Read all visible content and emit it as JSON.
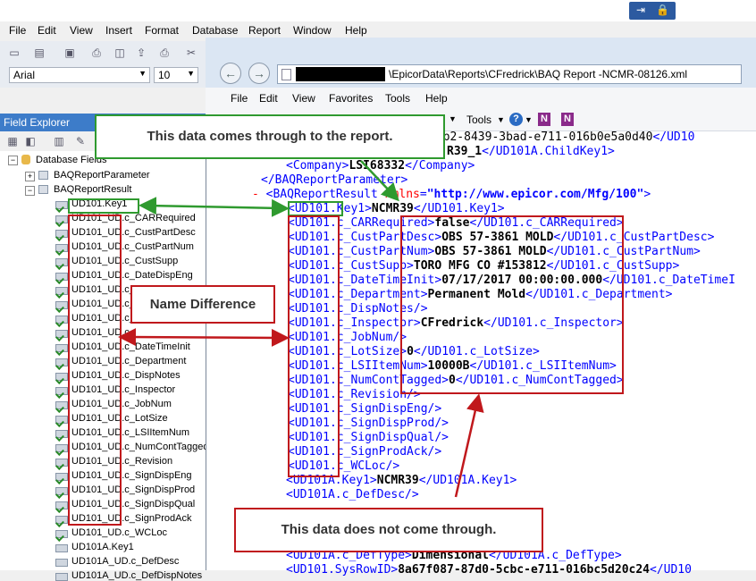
{
  "app": {
    "menu": [
      "File",
      "Edit",
      "View",
      "Insert",
      "Format",
      "Database",
      "Report",
      "Window",
      "Help"
    ],
    "font": {
      "name": "Arial",
      "size": "10"
    },
    "field_explorer_title": "Field Explorer",
    "tree": {
      "root": "Database Fields",
      "params": "BAQReportParameter",
      "result": "BAQReportResult",
      "fields": [
        "UD101.Key1",
        "UD101_UD.c_CARRequired",
        "UD101_UD.c_CustPartDesc",
        "UD101_UD.c_CustPartNum",
        "UD101_UD.c_CustSupp",
        "UD101_UD.c_DateDispEng",
        "UD101_UD.c_",
        "UD101_UD.c_",
        "UD101_UD.c_",
        "UD101_UD.c_",
        "UD101_UD.c_DateTimeInit",
        "UD101_UD.c_Department",
        "UD101_UD.c_DispNotes",
        "UD101_UD.c_Inspector",
        "UD101_UD.c_JobNum",
        "UD101_UD.c_LotSize",
        "UD101_UD.c_LSIItemNum",
        "UD101_UD.c_NumContTagged",
        "UD101_UD.c_Revision",
        "UD101_UD.c_SignDispEng",
        "UD101_UD.c_SignDispProd",
        "UD101_UD.c_SignDispQual",
        "UD101_UD.c_SignProdAck",
        "UD101_UD.c_WCLoc",
        "UD101A.Key1",
        "UD101A_UD.c_DefDesc",
        "UD101A_UD.c_DefDispNotes"
      ]
    }
  },
  "browser": {
    "url": "\\EpicorData\\Reports\\CFredrick\\BAQ Report -NCMR-08126.xml",
    "menu": [
      "File",
      "Edit",
      "View",
      "Favorites",
      "Tools",
      "Help"
    ],
    "tools_label": "Tools"
  },
  "xml": {
    "l0": "3bb2-8439-3bad-e711-016b0e5a0d40",
    "l0_close": "</UD10",
    "l1_val": "R39_1",
    "l1_close": "</UD101A.ChildKey1>",
    "company_open": "<Company>",
    "company_val": "LSI68332",
    "company_close": "</Company>",
    "params_close": "</BAQReportParameter>",
    "result_open": "<BAQReportResult ",
    "result_attr": "xmlns",
    "result_attrval": "\"http://www.epicor.com/Mfg/100\"",
    "rows": [
      {
        "open": "<UD101.Key1>",
        "val": "NCMR39",
        "close": "</UD101.Key1>"
      },
      {
        "open": "<UD101.c_CARRequired>",
        "val": "false",
        "close": "</UD101.c_CARRequired>"
      },
      {
        "open": "<UD101.c_CustPartDesc>",
        "val": "OBS 57-3861 MOLD",
        "close": "</UD101.c_CustPartDesc>"
      },
      {
        "open": "<UD101.c_CustPartNum>",
        "val": "OBS 57-3861 MOLD",
        "close": "</UD101.c_CustPartNum>"
      },
      {
        "open": "<UD101.c_CustSupp>",
        "val": "TORO MFG CO #153812",
        "close": "</UD101.c_CustSupp>"
      },
      {
        "open": "<UD101.c_DateTimeInit>",
        "val": "07/17/2017 00:00:00.000",
        "close": "</UD101.c_DateTimeI"
      },
      {
        "open": "<UD101.c_Department>",
        "val": "Permanent Mold",
        "close": "</UD101.c_Department>"
      },
      {
        "open": "<UD101.c_DispNotes/>",
        "val": "",
        "close": ""
      },
      {
        "open": "<UD101.c_Inspector>",
        "val": "CFredrick",
        "close": "</UD101.c_Inspector>"
      },
      {
        "open": "<UD101.c_JobNum/>",
        "val": "",
        "close": ""
      },
      {
        "open": "<UD101.c_LotSize>",
        "val": "0",
        "close": "</UD101.c_LotSize>"
      },
      {
        "open": "<UD101.c_LSIItemNum>",
        "val": "10000B",
        "close": "</UD101.c_LSIItemNum>"
      },
      {
        "open": "<UD101.c_NumContTagged>",
        "val": "0",
        "close": "</UD101.c_NumContTagged>"
      },
      {
        "open": "<UD101.c_Revision/>",
        "val": "",
        "close": ""
      },
      {
        "open": "<UD101.c_SignDispEng/>",
        "val": "",
        "close": ""
      },
      {
        "open": "<UD101.c_SignDispProd/>",
        "val": "",
        "close": ""
      },
      {
        "open": "<UD101.c_SignDispQual/>",
        "val": "",
        "close": ""
      },
      {
        "open": "<UD101.c_SignProdAck/>",
        "val": "",
        "close": ""
      },
      {
        "open": "<UD101.c_WCLoc/>",
        "val": "",
        "close": ""
      },
      {
        "open": "<UD101A.Key1>",
        "val": "NCMR39",
        "close": "</UD101A.Key1>"
      },
      {
        "open": "<UD101A.c_DefDesc/>",
        "val": "",
        "close": ""
      }
    ],
    "deftype_open": "<UD101A.c_DefType>",
    "deftype_val": "Dimensional",
    "deftype_close": "</UD101A.c_DefType>",
    "sysrow_open": "<UD101.SysRowID>",
    "sysrow_val": "8a67f087-87d0-5cbc-e711-016bc5d20c24",
    "sysrow_close": "</UD10"
  },
  "callouts": {
    "comes_through": "This data comes through to the report.",
    "name_diff": "Name Difference",
    "not_through": "This data does not come through."
  },
  "colors": {
    "green": "#2f9a2f",
    "red": "#c0181c",
    "xml_tag": "#0000ff"
  }
}
